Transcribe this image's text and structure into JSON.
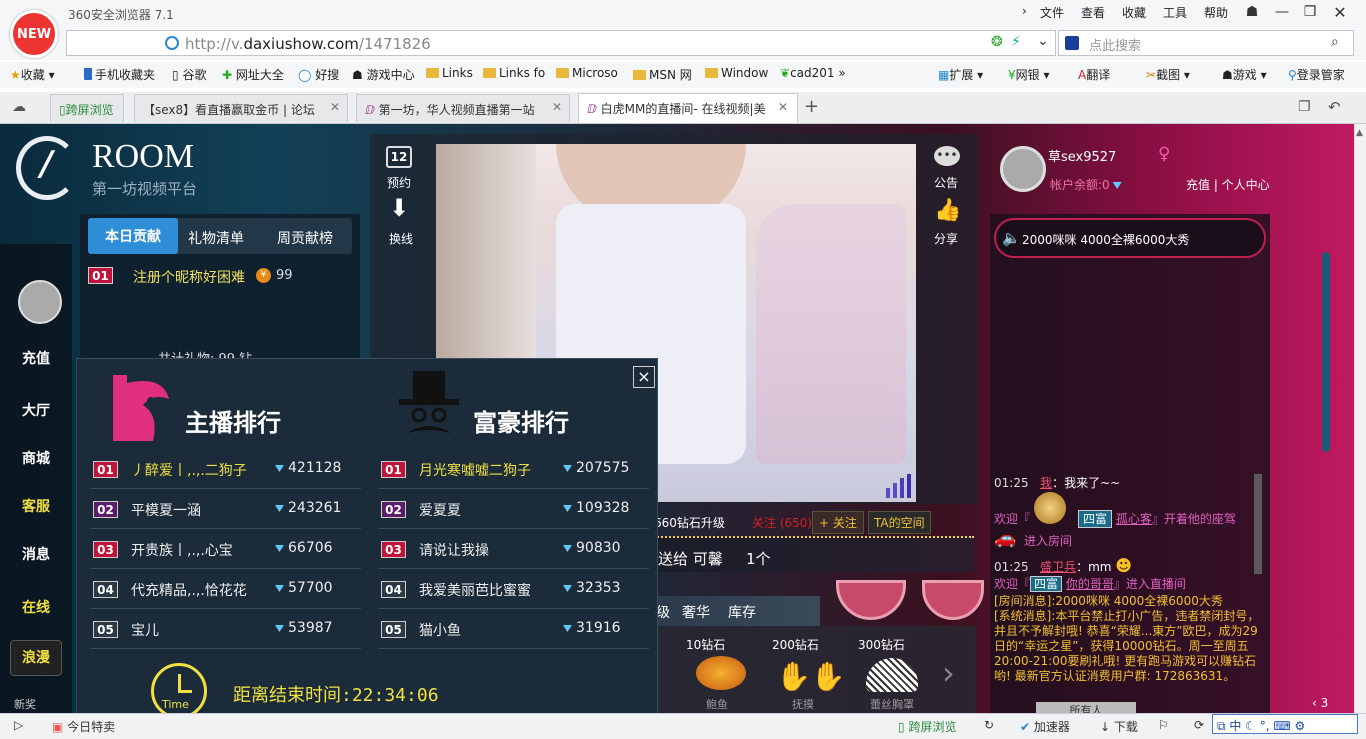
{
  "app": {
    "badge": "NEW",
    "title": "360安全浏览器 7.1"
  },
  "menu": [
    "文件",
    "查看",
    "收藏",
    "工具",
    "帮助"
  ],
  "address": {
    "scheme": "http://v.",
    "domain": "daxiushow.com",
    "path": "/1471826"
  },
  "search": {
    "placeholder": "点此搜索"
  },
  "bookmarks": [
    "收藏",
    "手机收藏夹",
    "谷歌",
    "网址大全",
    "好搜",
    "游戏中心",
    "Links",
    "Links fo",
    "Microso",
    "MSN 网",
    "Window",
    "cad201"
  ],
  "bookmarks_right": [
    "扩展",
    "网银",
    "翻译",
    "截图",
    "游戏",
    "登录管家"
  ],
  "tabs": [
    {
      "label": "跨屏浏览"
    },
    {
      "label": "【sex8】看直播赢取金币 | 论坛"
    },
    {
      "label": "第一坊，华人视频直播第一站"
    },
    {
      "label": "白虎MM的直播间- 在线视频|美"
    }
  ],
  "site": {
    "brand": "ROOM",
    "tagline": "第一坊视频平台"
  },
  "contrib_tabs": [
    "本日贡献",
    "礼物清单",
    "周贡献榜"
  ],
  "contrib_row": {
    "num": "01",
    "name": "注册个昵称好困难",
    "value": "99"
  },
  "contrib_total": "共计礼物: 99 钻",
  "left_nav": [
    "充值",
    "大厅",
    "商城",
    "客服",
    "消息",
    "在线",
    "浪漫"
  ],
  "left_nav_small": "新奖",
  "video_side": {
    "reserve": "预约",
    "reserve_day": "12",
    "switch": "换线",
    "notice": "公告",
    "share": "分享"
  },
  "rank_popup": {
    "anchor_title": "主播排行",
    "rich_title": "富豪排行",
    "anchors": [
      {
        "num": "01",
        "name": "丿醉爱丨,.,.二狗子",
        "value": "421128"
      },
      {
        "num": "02",
        "name": "平模夏一涵",
        "value": "243261"
      },
      {
        "num": "03",
        "name": "开贵族丨,.,.心宝",
        "value": "66706"
      },
      {
        "num": "04",
        "name": "代充精品,.,.恰花花",
        "value": "57700"
      },
      {
        "num": "05",
        "name": "宝儿",
        "value": "53987"
      }
    ],
    "rich": [
      {
        "num": "01",
        "name": "月光寒嘘嘘二狗子",
        "value": "207575"
      },
      {
        "num": "02",
        "name": "爱夏夏",
        "value": "109328"
      },
      {
        "num": "03",
        "name": "请说让我操",
        "value": "90830"
      },
      {
        "num": "04",
        "name": "我爱美丽芭比蜜蜜",
        "value": "32353"
      },
      {
        "num": "05",
        "name": "猫小鱼",
        "value": "31916"
      }
    ],
    "countdown_label": "距离结束时间:22:34:06",
    "time_label": "Time",
    "close": "×"
  },
  "stream_bar": {
    "upgrade": "660钻石升级",
    "follow_count": "关注 (650)",
    "follow_btn": "+ 关注",
    "space": "TA的空间"
  },
  "marquee": {
    "text": "送给 可馨",
    "count": "1个"
  },
  "gift_tabs": [
    "级",
    "奢华",
    "库存"
  ],
  "gifts": [
    {
      "label": "10钻石",
      "name": "鲍鱼"
    },
    {
      "label": "200钻石",
      "name": "抚摸"
    },
    {
      "label": "300钻石",
      "name": "蕾丝胸罩"
    }
  ],
  "user": {
    "name": "草sex9527",
    "balance": "帐户余额:0",
    "links": "充值 | 个人中心"
  },
  "announce": "2000咪咪 4000全裸6000大秀",
  "chat": [
    {
      "time": "01:25",
      "user": "我",
      "text": "：我来了~~"
    },
    {
      "prefix": "欢迎『",
      "badge": "四富",
      "user": "孤心客",
      "text": "』开着他的座驾"
    },
    {
      "text": "进入房间"
    },
    {
      "time": "01:25",
      "user": "盛卫兵",
      "text": "：mm"
    },
    {
      "prefix": "欢迎『",
      "badge": "四富",
      "user": "你的哥哥",
      "text": "』进入直播间"
    }
  ],
  "sysmsg": "[房间消息]:2000咪咪 4000全裸6000大秀\n[系统消息]:本平台禁止打小广告，违者禁闭封号，并且不予解封哦! 恭喜“荣耀...東方”欧巴，成为29日的“幸运之星”，获得10000钻石。周一至周五20:00-21:00要刷礼哦! 更有跑马游戏可以赚钻石哟! 最新官方认证消费用户群: 172863631。",
  "right_bottom": {
    "viewers": "所有人",
    "page": "3"
  },
  "status": {
    "today": "今日特卖",
    "right": [
      "跨屏浏览",
      "加速器",
      "下载"
    ]
  }
}
